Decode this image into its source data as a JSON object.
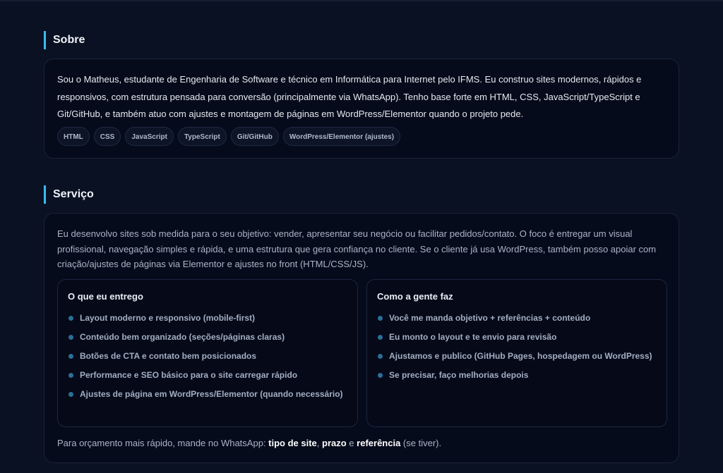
{
  "about": {
    "title": "Sobre",
    "text": "Sou o Matheus, estudante de Engenharia de Software e técnico em Informática para Internet pelo IFMS. Eu construo sites modernos, rápidos e responsivos, com estrutura pensada para conversão (principalmente via WhatsApp). Tenho base forte em HTML, CSS, JavaScript/TypeScript e Git/GitHub, e também atuo com ajustes e montagem de páginas em WordPress/Elementor quando o projeto pede.",
    "tags": [
      "HTML",
      "CSS",
      "JavaScript",
      "TypeScript",
      "Git/GitHub",
      "WordPress/Elementor (ajustes)"
    ]
  },
  "service": {
    "title": "Serviço",
    "text": "Eu desenvolvo sites sob medida para o seu objetivo: vender, apresentar seu negócio ou facilitar pedidos/contato. O foco é entregar um visual profissional, navegação simples e rápida, e uma estrutura que gera confiança no cliente. Se o cliente já usa WordPress, também posso apoiar com criação/ajustes de páginas via Elementor e ajustes no front (HTML/CSS/JS).",
    "deliver": {
      "title": "O que eu entrego",
      "items": [
        "Layout moderno e responsivo (mobile-first)",
        "Conteúdo bem organizado (seções/páginas claras)",
        "Botões de CTA e contato bem posicionados",
        "Performance e SEO básico para o site carregar rápido",
        "Ajustes de página em WordPress/Elementor (quando necessário)"
      ]
    },
    "process": {
      "title": "Como a gente faz",
      "items": [
        "Você me manda objetivo + referências + conteúdo",
        "Eu monto o layout e te envio para revisão",
        "Ajustamos e publico (GitHub Pages, hospedagem ou WordPress)",
        "Se precisar, faço melhorias depois"
      ]
    },
    "note": {
      "prefix": "Para orçamento mais rápido, mande no WhatsApp: ",
      "term1": "tipo de site",
      "sep1": ", ",
      "term2": "prazo",
      "sep2": " e ",
      "term3": "referência",
      "suffix": " (se tiver)."
    }
  },
  "colors": {
    "background": "#0a1122",
    "card": "#060b1b",
    "accent": "#38bdf8",
    "bullet": "#2b6f98"
  }
}
